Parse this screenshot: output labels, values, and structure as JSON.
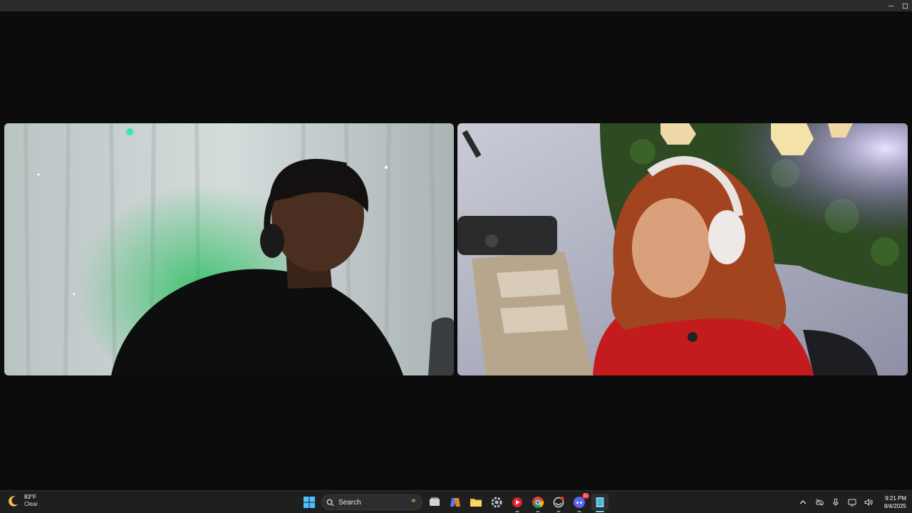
{
  "window": {
    "minimize_icon": "minimize-icon",
    "maximize_icon": "maximize-icon"
  },
  "call": {
    "participants": [
      {
        "id": "left",
        "scene": "man with black headset, white curtain background, green lighting"
      },
      {
        "id": "right",
        "scene": "woman with white headphones, red shirt, microphone and plant wall background"
      }
    ]
  },
  "taskbar": {
    "weather": {
      "temperature": "83°F",
      "condition": "Clear",
      "icon": "moon-icon"
    },
    "search": {
      "label": "Search"
    },
    "apps": [
      {
        "name": "start-button",
        "icon": "windows-icon"
      },
      {
        "name": "task-view-button",
        "icon": "task-view-icon"
      },
      {
        "name": "copilot-button",
        "icon": "copilot-icon"
      },
      {
        "name": "file-explorer-button",
        "icon": "folder-icon"
      },
      {
        "name": "settings-button",
        "icon": "gear-icon"
      },
      {
        "name": "media-player-button",
        "icon": "media-icon"
      },
      {
        "name": "chrome-button",
        "icon": "chrome-icon"
      },
      {
        "name": "app-button",
        "icon": "app-icon"
      },
      {
        "name": "discord-button",
        "icon": "discord-icon",
        "badge": "11"
      },
      {
        "name": "notepad-button",
        "icon": "notepad-icon"
      }
    ],
    "clock": {
      "time": "9:21 PM",
      "date": "8/4/2025"
    }
  },
  "colors": {
    "taskbar_bg": "#1f1f1f",
    "accent": "#60cdff",
    "background": "#0c0c0c"
  }
}
